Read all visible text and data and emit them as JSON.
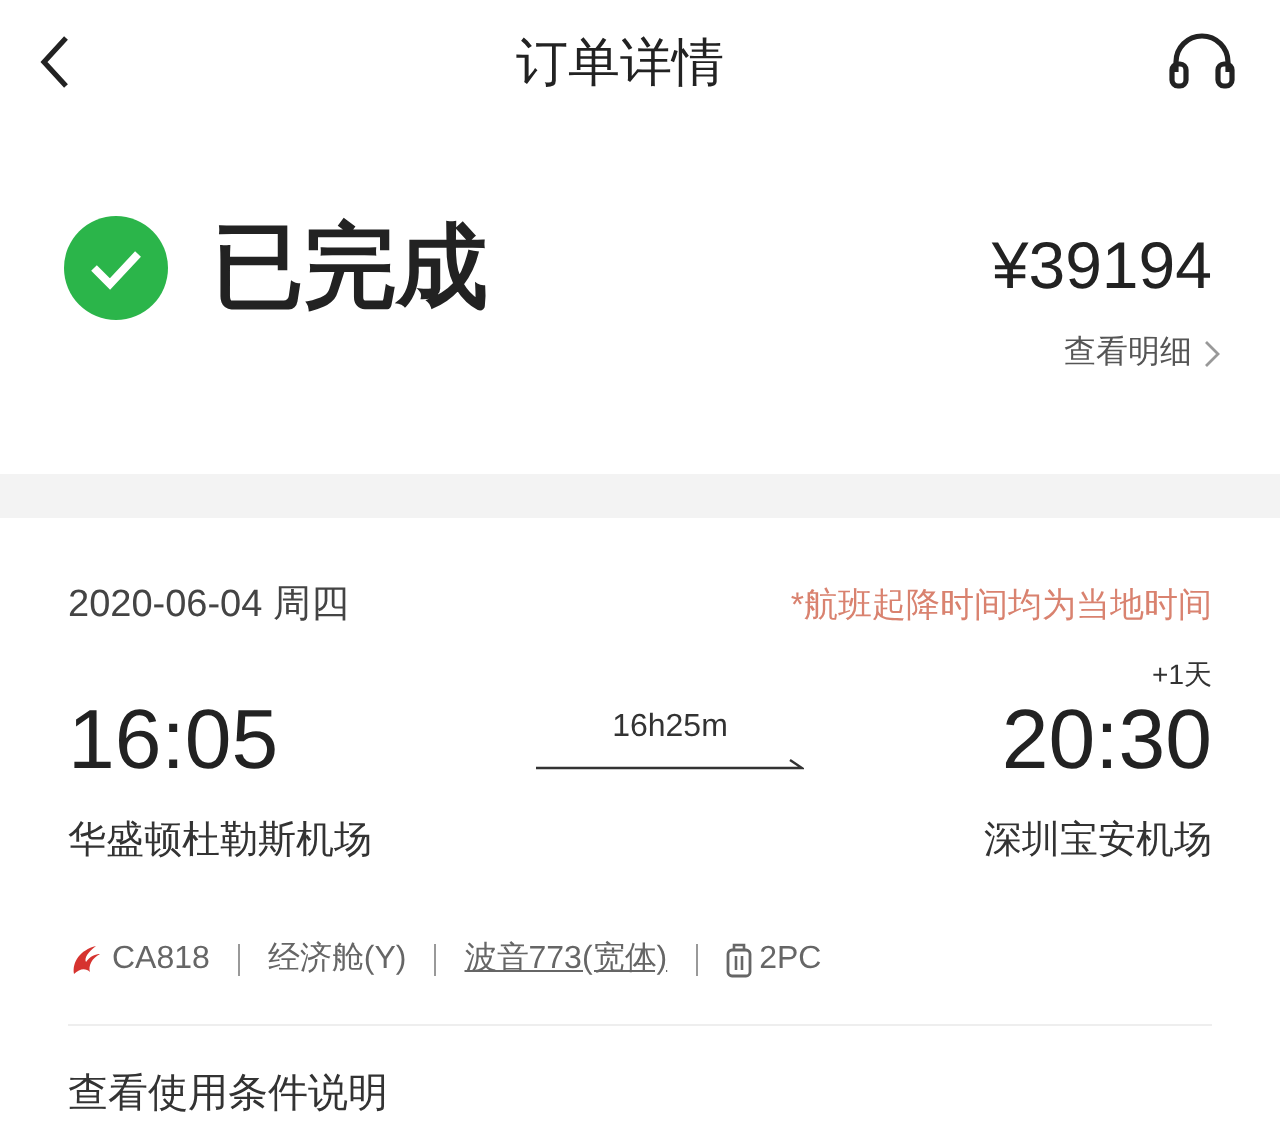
{
  "header": {
    "title": "订单详情"
  },
  "status": {
    "label": "已完成",
    "price": "¥39194",
    "details_link": "查看明细"
  },
  "flight": {
    "date": "2020-06-04 周四",
    "note": "*航班起降时间均为当地时间",
    "departure": {
      "time": "16:05",
      "airport": "华盛顿杜勒斯机场"
    },
    "duration": "16h25m",
    "arrival": {
      "time": "20:30",
      "day_offset": "+1天",
      "airport": "深圳宝安机场"
    },
    "info": [
      {
        "kind": "airline",
        "text": "CA818"
      },
      {
        "kind": "plain",
        "text": "经济舱(Y)"
      },
      {
        "kind": "link",
        "text": "波音773(宽体)"
      },
      {
        "kind": "baggage",
        "text": "2PC"
      }
    ]
  },
  "footer": {
    "link": "查看使用条件说明"
  }
}
